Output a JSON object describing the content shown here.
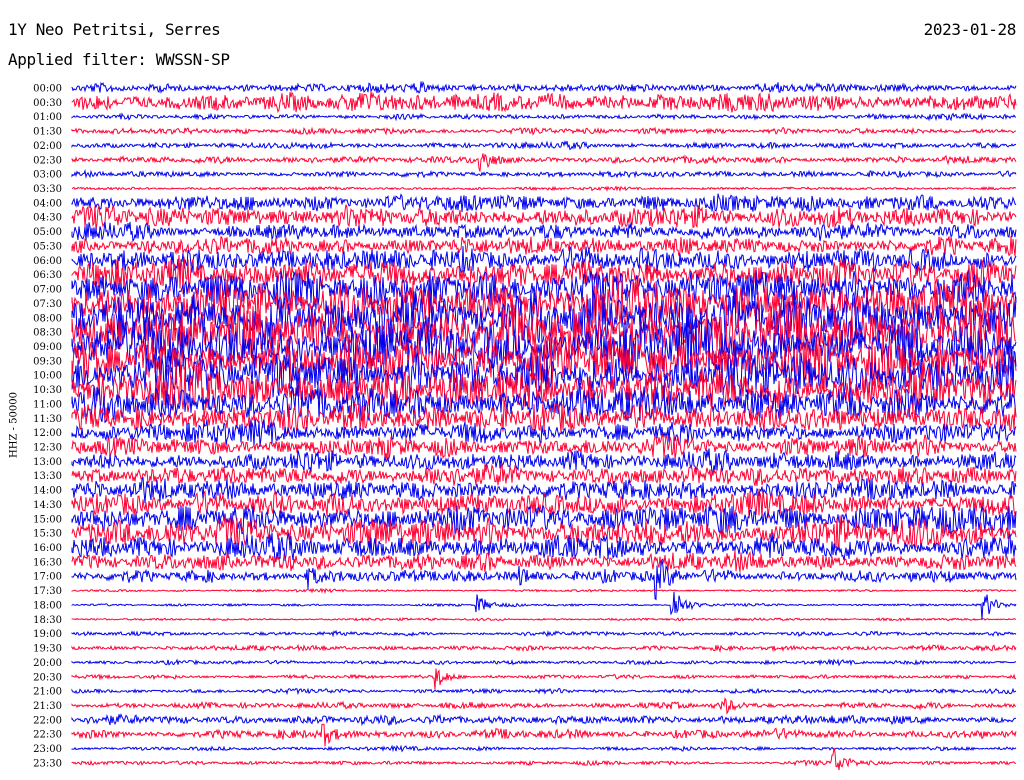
{
  "header": {
    "station": "1Y Neo Petritsi, Serres",
    "date": "2023-01-28",
    "filter_label": "Applied filter: WWSSN-SP"
  },
  "chart_data": {
    "type": "line",
    "title": "1Y Neo Petritsi, Serres",
    "date": "2023-01-28",
    "filter": "WWSSN-SP",
    "ylabel": "HHZ - 50000",
    "rows": [
      "00:00",
      "00:30",
      "01:00",
      "01:30",
      "02:00",
      "02:30",
      "03:00",
      "03:30",
      "04:00",
      "04:30",
      "05:00",
      "05:30",
      "06:00",
      "06:30",
      "07:00",
      "07:30",
      "08:00",
      "08:30",
      "09:00",
      "09:30",
      "10:00",
      "10:30",
      "11:00",
      "11:30",
      "12:00",
      "12:30",
      "13:00",
      "13:30",
      "14:00",
      "14:30",
      "15:00",
      "15:30",
      "16:00",
      "16:30",
      "17:00",
      "17:30",
      "18:00",
      "18:30",
      "19:00",
      "19:30",
      "20:00",
      "20:30",
      "21:00",
      "21:30",
      "22:00",
      "22:30",
      "23:00",
      "23:30"
    ],
    "trace_colors": [
      "#0000ee",
      "#ff0033"
    ],
    "noise_amplitude_relative": [
      0.45,
      0.9,
      0.25,
      0.3,
      0.3,
      0.35,
      0.3,
      0.15,
      0.9,
      1.1,
      0.8,
      0.9,
      1.2,
      1.6,
      1.9,
      2.2,
      2.6,
      2.6,
      2.6,
      2.4,
      2.3,
      2.1,
      1.8,
      1.4,
      1.1,
      1.0,
      1.0,
      1.0,
      1.1,
      1.2,
      1.5,
      1.5,
      1.2,
      0.9,
      0.6,
      0.12,
      0.12,
      0.12,
      0.2,
      0.25,
      0.2,
      0.2,
      0.22,
      0.3,
      0.45,
      0.45,
      0.2,
      0.2
    ],
    "events": [
      {
        "row": "02:30",
        "time_min": 13.0,
        "amp": 12
      },
      {
        "row": "17:00",
        "time_min": 7.5,
        "amp": 10
      },
      {
        "row": "17:00",
        "time_min": 14.3,
        "amp": 9
      },
      {
        "row": "17:00",
        "time_min": 18.6,
        "amp": 18
      },
      {
        "row": "18:00",
        "time_min": 12.9,
        "amp": 10
      },
      {
        "row": "18:00",
        "time_min": 19.1,
        "amp": 22
      },
      {
        "row": "18:00",
        "time_min": 29.0,
        "amp": 14
      },
      {
        "row": "20:30",
        "time_min": 11.6,
        "amp": 12
      },
      {
        "row": "21:30",
        "time_min": 20.7,
        "amp": 8
      },
      {
        "row": "22:30",
        "time_min": 8.0,
        "amp": 11
      },
      {
        "row": "23:30",
        "time_min": 24.2,
        "amp": 16
      }
    ],
    "grid": false,
    "legend": "none"
  }
}
